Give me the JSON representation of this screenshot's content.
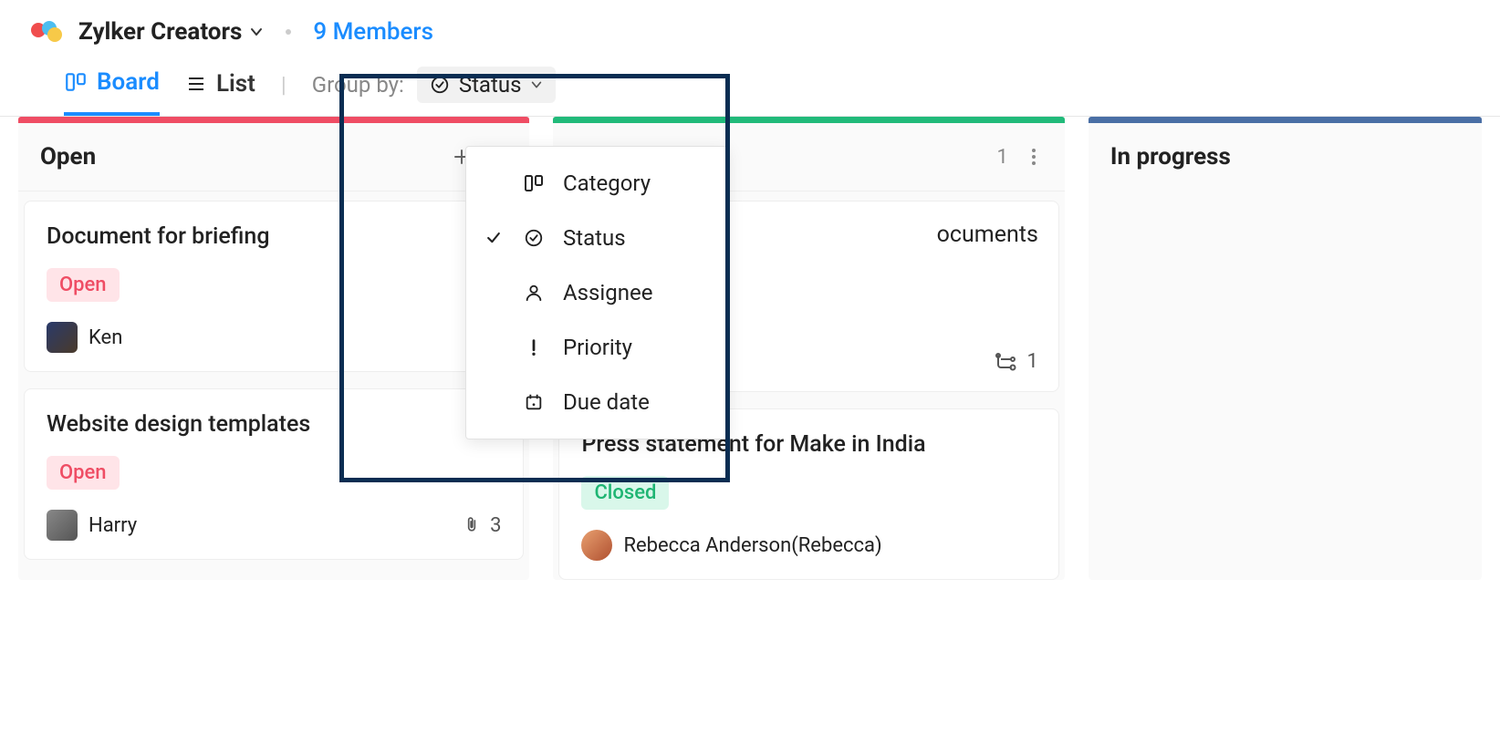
{
  "header": {
    "team_name": "Zylker Creators",
    "members_link": "9 Members"
  },
  "viewbar": {
    "board_label": "Board",
    "list_label": "List",
    "groupby_label": "Group by:",
    "groupby_value": "Status"
  },
  "groupby_dropdown": {
    "options": [
      {
        "label": "Category",
        "icon": "category",
        "selected": false
      },
      {
        "label": "Status",
        "icon": "status",
        "selected": true
      },
      {
        "label": "Assignee",
        "icon": "assignee",
        "selected": false
      },
      {
        "label": "Priority",
        "icon": "priority",
        "selected": false
      },
      {
        "label": "Due date",
        "icon": "duedate",
        "selected": false
      }
    ]
  },
  "columns": [
    {
      "id": "open",
      "title": "Open",
      "stripe": "red",
      "count": null,
      "show_actions": "plus+kebab",
      "cards": [
        {
          "title": "Document for briefing",
          "status": {
            "label": "Open",
            "kind": "open"
          },
          "assignee": {
            "name": "Ken",
            "avatar": "ken"
          },
          "meta": null
        },
        {
          "title": "Website design templates",
          "status": {
            "label": "Open",
            "kind": "open"
          },
          "assignee": {
            "name": "Harry",
            "avatar": "harry"
          },
          "meta": {
            "icon": "attachment",
            "value": "3"
          }
        }
      ]
    },
    {
      "id": "closed",
      "title_visible": "ocuments",
      "stripe": "green",
      "count": "1",
      "show_actions": "count+kebab",
      "cards": [
        {
          "title_hidden": true,
          "status": null,
          "assignee": null,
          "meta": {
            "icon": "subtasks",
            "value": "1"
          }
        },
        {
          "title": "Press statement for Make in India",
          "status": {
            "label": "Closed",
            "kind": "closed"
          },
          "assignee": {
            "name": "Rebecca Anderson(Rebecca)",
            "avatar": "rebecca"
          },
          "meta": null
        }
      ]
    },
    {
      "id": "inprogress",
      "title": "In progress",
      "stripe": "blue",
      "count": null,
      "show_actions": "none",
      "cards": []
    }
  ]
}
